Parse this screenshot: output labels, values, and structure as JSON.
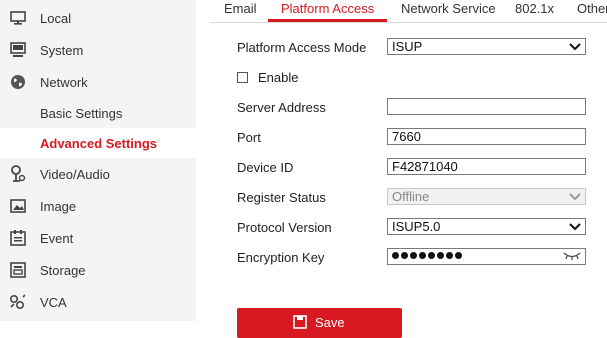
{
  "sidebar": {
    "items": [
      {
        "label": "Local",
        "icon": "monitor-icon"
      },
      {
        "label": "System",
        "icon": "computer-icon"
      },
      {
        "label": "Network",
        "icon": "globe-icon"
      },
      {
        "label": "Basic Settings"
      },
      {
        "label": "Advanced Settings",
        "active": true
      },
      {
        "label": "Video/Audio",
        "icon": "video-audio-icon"
      },
      {
        "label": "Image",
        "icon": "image-icon"
      },
      {
        "label": "Event",
        "icon": "event-icon"
      },
      {
        "label": "Storage",
        "icon": "storage-icon"
      },
      {
        "label": "VCA",
        "icon": "vca-icon"
      }
    ]
  },
  "tabs": [
    "Email",
    "Platform Access",
    "Network Service",
    "802.1x",
    "Other"
  ],
  "active_tab": "Platform Access",
  "form": {
    "platform_access_mode": {
      "label": "Platform Access Mode",
      "value": "ISUP"
    },
    "enable": {
      "label": "Enable",
      "checked": false
    },
    "server_address": {
      "label": "Server Address",
      "value": ""
    },
    "port": {
      "label": "Port",
      "value": "7660"
    },
    "device_id": {
      "label": "Device ID",
      "value": "F42871040"
    },
    "register_status": {
      "label": "Register Status",
      "value": "Offline"
    },
    "protocol_version": {
      "label": "Protocol Version",
      "value": "ISUP5.0"
    },
    "encryption_key": {
      "label": "Encryption Key",
      "masked_length": 8
    }
  },
  "save_label": "Save",
  "colors": {
    "accent": "#d71a21",
    "sidebar_bg": "#f4f4f4"
  }
}
